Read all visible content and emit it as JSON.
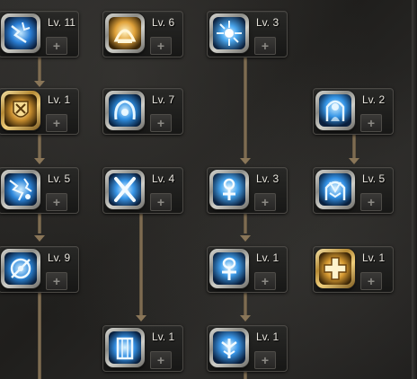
{
  "skill_tree": {
    "nodes": [
      {
        "id": "r1c1",
        "level": "Lv. 11",
        "plus": "+",
        "icon": "lightning-orb-icon",
        "frame": "silver"
      },
      {
        "id": "r1c2",
        "level": "Lv. 6",
        "plus": "+",
        "icon": "golden-dome-icon",
        "frame": "gold"
      },
      {
        "id": "r1c3",
        "level": "Lv. 3",
        "plus": "+",
        "icon": "radiant-burst-icon",
        "frame": "silver"
      },
      {
        "id": "r2c1",
        "level": "Lv. 1",
        "plus": "+",
        "icon": "golden-cross-shield-icon",
        "frame": "gold"
      },
      {
        "id": "r2c2",
        "level": "Lv. 7",
        "plus": "+",
        "icon": "blue-aura-icon",
        "frame": "silver"
      },
      {
        "id": "r2c4",
        "level": "Lv. 2",
        "plus": "+",
        "icon": "blue-guardian-icon",
        "frame": "silver"
      },
      {
        "id": "r3c1",
        "level": "Lv. 5",
        "plus": "+",
        "icon": "shattered-lightning-icon",
        "frame": "silver"
      },
      {
        "id": "r3c2",
        "level": "Lv. 4",
        "plus": "+",
        "icon": "crossed-blades-icon",
        "frame": "silver"
      },
      {
        "id": "r3c3",
        "level": "Lv. 3",
        "plus": "+",
        "icon": "cross-glyph-icon",
        "frame": "silver"
      },
      {
        "id": "r3c4",
        "level": "Lv. 5",
        "plus": "+",
        "icon": "winged-guardian-icon",
        "frame": "silver"
      },
      {
        "id": "r4c1",
        "level": "Lv. 9",
        "plus": "+",
        "icon": "spinning-ring-icon",
        "frame": "silver"
      },
      {
        "id": "r4c3",
        "level": "Lv. 1",
        "plus": "+",
        "icon": "ankh-glyph-icon",
        "frame": "silver"
      },
      {
        "id": "r4c4",
        "level": "Lv. 1",
        "plus": "+",
        "icon": "golden-cross-icon",
        "frame": "gold"
      },
      {
        "id": "r5c2",
        "level": "Lv. 1",
        "plus": "+",
        "icon": "blue-pillar-icon",
        "frame": "silver"
      },
      {
        "id": "r5c3",
        "level": "Lv. 1",
        "plus": "+",
        "icon": "tree-glyph-icon",
        "frame": "silver"
      }
    ]
  },
  "colors": {
    "connector": "#8a7658",
    "level_text": "#e7e4dc",
    "icon_blue": "#3fa9ff",
    "icon_gold": "#e8b44c"
  }
}
